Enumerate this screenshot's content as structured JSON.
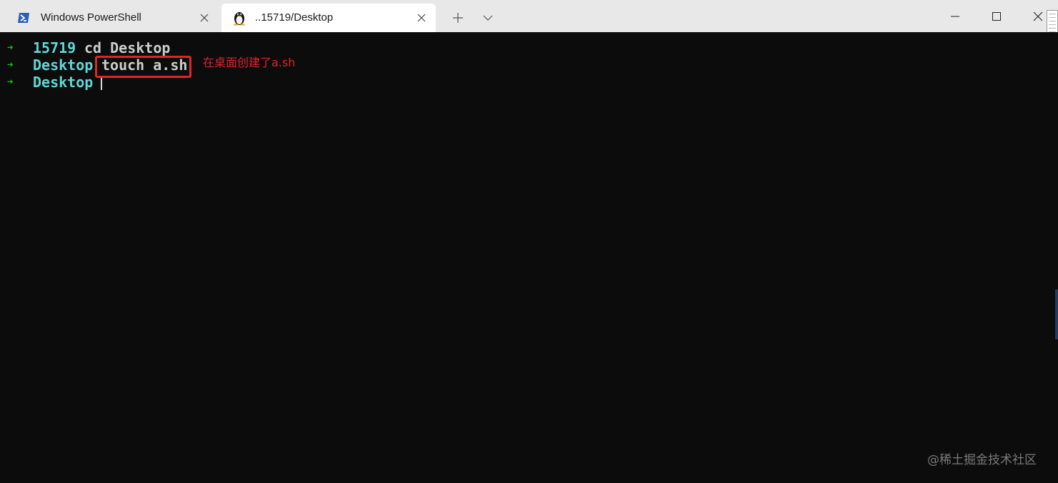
{
  "window": {
    "tabs": [
      {
        "label": "Windows PowerShell",
        "icon": "powershell-icon",
        "active": false
      },
      {
        "label": "..15719/Desktop",
        "icon": "linux-penguin-icon",
        "active": true
      }
    ],
    "controls": {
      "new_tab_icon": "plus-icon",
      "dropdown_icon": "chevron-down-icon",
      "minimize_icon": "minimize-icon",
      "maximize_icon": "maximize-icon",
      "close_icon": "close-icon"
    }
  },
  "terminal": {
    "lines": [
      {
        "prompt": "➜",
        "dir": "15719",
        "command": "cd Desktop"
      },
      {
        "prompt": "➜",
        "dir": "Desktop",
        "command": "touch a.sh"
      },
      {
        "prompt": "➜",
        "dir": "Desktop",
        "command": ""
      }
    ],
    "annotation": "在桌面创建了a.sh",
    "watermark": "@稀土掘金技术社区"
  },
  "colors": {
    "background": "#0c0c0c",
    "prompt_arrow": "#16c60c",
    "directory": "#61d6d6",
    "command_text": "#cccccc",
    "annotation": "#e0242c",
    "tabbar": "#e8e8e8",
    "active_tab": "#ffffff"
  }
}
